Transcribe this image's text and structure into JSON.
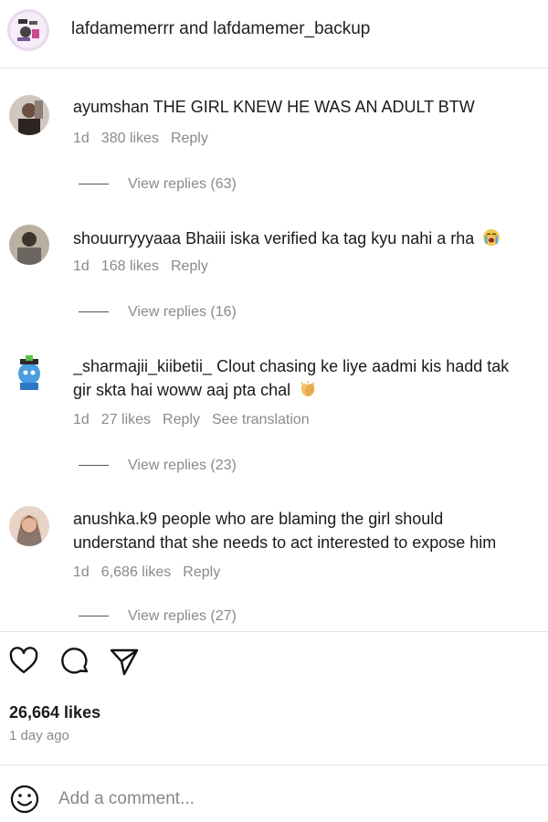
{
  "header": {
    "title": "lafdamemerrr and lafdamemer_backup"
  },
  "comments": [
    {
      "username": "ayumshan",
      "text": "THE GIRL KNEW HE WAS AN ADULT BTW",
      "time": "1d",
      "likes": "380 likes",
      "reply": "Reply",
      "view_replies": "View replies (63)"
    },
    {
      "username": "shouurryyyaaa",
      "text": "Bhaiii iska verified ka tag kyu nahi a rha",
      "emoji": "crying-face",
      "time": "1d",
      "likes": "168 likes",
      "reply": "Reply",
      "view_replies": "View replies (16)"
    },
    {
      "username": "_sharmajii_kiibetii_",
      "text_line1": "Clout chasing ke liye aadmi kis hadd tak",
      "text_line2": "gir skta hai woww aaj pta chal",
      "emoji": "clapping-hands",
      "time": "1d",
      "likes": "27 likes",
      "reply": "Reply",
      "translation": "See translation",
      "view_replies": "View replies (23)"
    },
    {
      "username": "anushka.k9",
      "text_line1": "people who are blaming the girl should",
      "text_line2": "understand that she needs to act interested to expose him",
      "time": "1d",
      "likes": "6,686 likes",
      "reply": "Reply",
      "view_replies": "View replies (27)"
    }
  ],
  "post": {
    "likes": "26,664 likes",
    "time_ago": "1 day ago"
  },
  "add_comment": {
    "placeholder": "Add a comment..."
  },
  "icons": [
    "heart-icon",
    "comment-icon",
    "share-icon",
    "smile-icon"
  ]
}
